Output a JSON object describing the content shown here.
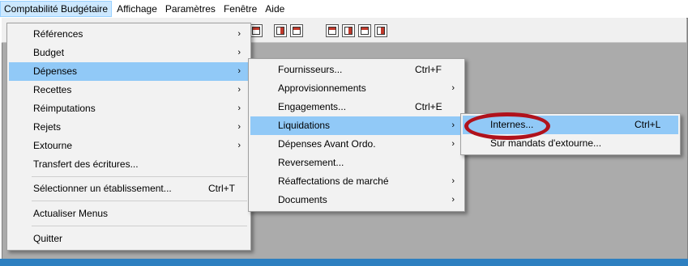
{
  "menubar": {
    "items": [
      {
        "label": "Comptabilité Budgétaire"
      },
      {
        "label": "Affichage"
      },
      {
        "label": "Paramètres"
      },
      {
        "label": "Fenêtre"
      },
      {
        "label": "Aide"
      }
    ]
  },
  "main_menu": {
    "items": [
      {
        "label": "Références",
        "arrow": "›"
      },
      {
        "label": "Budget",
        "arrow": "›"
      },
      {
        "label": "Dépenses",
        "arrow": "›"
      },
      {
        "label": "Recettes",
        "arrow": "›"
      },
      {
        "label": "Réimputations",
        "arrow": "›"
      },
      {
        "label": "Rejets",
        "arrow": "›"
      },
      {
        "label": "Extourne",
        "arrow": "›"
      },
      {
        "label": "Transfert des écritures..."
      },
      {
        "label": "Sélectionner un établissement...",
        "shortcut": "Ctrl+T"
      },
      {
        "label": "Actualiser Menus"
      },
      {
        "label": "Quitter"
      }
    ]
  },
  "depenses_menu": {
    "items": [
      {
        "label": "Fournisseurs...",
        "shortcut": "Ctrl+F"
      },
      {
        "label": "Approvisionnements",
        "arrow": "›"
      },
      {
        "label": "Engagements...",
        "shortcut": "Ctrl+E"
      },
      {
        "label": "Liquidations",
        "arrow": "›"
      },
      {
        "label": "Dépenses Avant Ordo.",
        "arrow": "›"
      },
      {
        "label": "Reversement..."
      },
      {
        "label": "Réaffectations de marché",
        "arrow": "›"
      },
      {
        "label": "Documents",
        "arrow": "›"
      }
    ]
  },
  "liquidations_menu": {
    "items": [
      {
        "label": "Internes...",
        "shortcut": "Ctrl+L"
      },
      {
        "label": "Sur mandats d'extourne..."
      }
    ]
  },
  "colors": {
    "highlight": "#91c9f7",
    "annotation": "#b0121c",
    "bottom_bar": "#2d7fc0"
  }
}
